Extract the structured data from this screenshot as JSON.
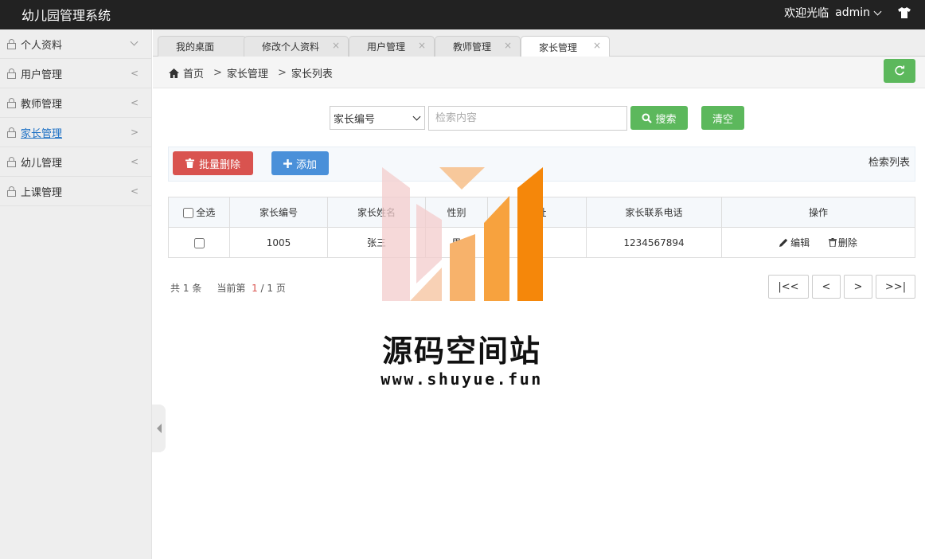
{
  "app": {
    "title": "幼儿园管理系统"
  },
  "topbar": {
    "welcome": "欢迎光临",
    "user": "admin"
  },
  "sidebar": {
    "items": [
      {
        "label": "个人资料"
      },
      {
        "label": "用户管理",
        "arrow": "<"
      },
      {
        "label": "教师管理",
        "arrow": "<"
      },
      {
        "label": "家长管理",
        "arrow": ">"
      },
      {
        "label": "幼儿管理",
        "arrow": "<"
      },
      {
        "label": "上课管理",
        "arrow": "<"
      }
    ]
  },
  "tabs": [
    {
      "label": "我的桌面"
    },
    {
      "label": "修改个人资料"
    },
    {
      "label": "用户管理"
    },
    {
      "label": "教师管理"
    },
    {
      "label": "家长管理"
    }
  ],
  "breadcrumb": {
    "home": "首页",
    "level1": "家长管理",
    "level2": "家长列表",
    "sep": ">"
  },
  "search": {
    "field": "家长编号",
    "placeholder": "检索内容",
    "search_label": "搜索",
    "clear_label": "清空"
  },
  "toolbar": {
    "batch_delete": "批量删除",
    "add": "添加",
    "list_label": "检索列表"
  },
  "table": {
    "headers": [
      "全选",
      "家长编号",
      "家长姓名",
      "性别",
      "地址",
      "家长联系电话",
      "操作"
    ],
    "rows": [
      {
        "id": "1005",
        "name": "张三",
        "gender": "男",
        "address": "市",
        "phone": "1234567894"
      }
    ],
    "edit_label": "编辑",
    "delete_label": "删除"
  },
  "pager": {
    "total_prefix": "共",
    "total": "1",
    "total_suffix": "条",
    "current_prefix": "当前第",
    "current": "1",
    "pages": "/ 1 页",
    "first": "|<<",
    "prev": "<",
    "next": ">",
    "last": ">>|"
  },
  "watermark": {
    "title": "源码空间站",
    "url": "www.shuyue.fun"
  }
}
